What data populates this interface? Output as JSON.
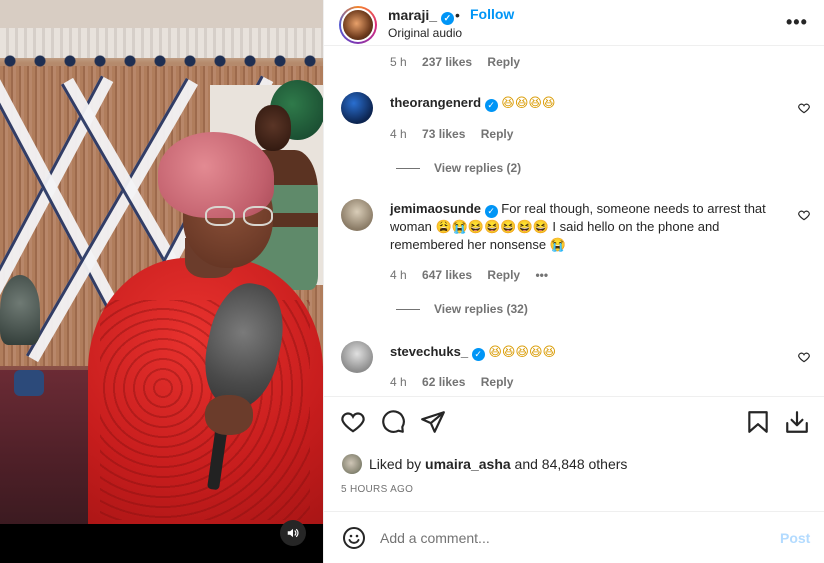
{
  "post": {
    "username": "maraji_",
    "dot": "•",
    "follow_label": "Follow",
    "audio": "Original audio",
    "more_label": "•••"
  },
  "previous_comment_meta": {
    "time": "5 h",
    "likes": "237 likes",
    "reply": "Reply"
  },
  "comments": [
    {
      "user": "theorangenerd",
      "text": "😆😆😆😆",
      "time": "4 h",
      "likes": "73 likes",
      "reply": "Reply",
      "view_replies": "View replies (2)",
      "avatar_color": "#1a4f9c"
    },
    {
      "user": "jemimaosunde",
      "text": "For real though, someone needs to arrest that woman 😩😭😆😆😆😆😆 I said hello on the phone and remembered her nonsense 😭",
      "time": "4 h",
      "likes": "647 likes",
      "reply": "Reply",
      "more": "•••",
      "view_replies": "View replies (32)",
      "avatar_color": "#cfc3b2"
    },
    {
      "user": "stevechuks_",
      "text": "😆😆😆😆😆",
      "time": "4 h",
      "likes": "62 likes",
      "reply": "Reply",
      "avatar_color": "#bdbdbd"
    }
  ],
  "likes": {
    "prefix": "Liked by",
    "user": "umaira_asha",
    "suffix": "and 84,848 others"
  },
  "time_ago": "5 HOURS AGO",
  "add_comment": {
    "placeholder": "Add a comment...",
    "post_label": "Post"
  },
  "icons": [
    "heart-icon",
    "comment-icon",
    "share-icon",
    "bookmark-icon",
    "download-icon",
    "emoji-icon",
    "speaker-icon",
    "verified-icon",
    "more-icon"
  ],
  "colors": {
    "accent": "#0095f6",
    "post_disabled": "#b3dbff",
    "secondary_text": "#737373"
  }
}
